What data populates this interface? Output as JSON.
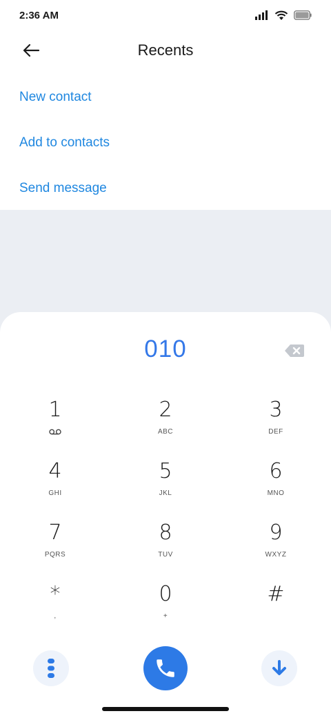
{
  "status_bar": {
    "time": "2:36 AM"
  },
  "header": {
    "title": "Recents"
  },
  "menu": [
    {
      "label": "New contact"
    },
    {
      "label": "Add to contacts"
    },
    {
      "label": "Send message"
    }
  ],
  "dialer": {
    "number": "010"
  },
  "keys": [
    {
      "digit": "1",
      "letters": ""
    },
    {
      "digit": "2",
      "letters": "ABC"
    },
    {
      "digit": "3",
      "letters": "DEF"
    },
    {
      "digit": "4",
      "letters": "GHI"
    },
    {
      "digit": "5",
      "letters": "JKL"
    },
    {
      "digit": "6",
      "letters": "MNO"
    },
    {
      "digit": "7",
      "letters": "PQRS"
    },
    {
      "digit": "8",
      "letters": "TUV"
    },
    {
      "digit": "9",
      "letters": "WXYZ"
    },
    {
      "digit": "*",
      "letters": ","
    },
    {
      "digit": "0",
      "letters": "+"
    },
    {
      "digit": "#",
      "letters": ""
    }
  ],
  "colors": {
    "accent": "#2d7ae6",
    "link": "#1f87e0",
    "background_gray": "#ebeef3"
  },
  "icons": {
    "key_1_sub": "voicemail-icon",
    "back": "arrow-left-icon",
    "backspace": "backspace-icon",
    "more": "more-vertical-icon",
    "call": "phone-icon",
    "hide": "arrow-down-icon"
  }
}
